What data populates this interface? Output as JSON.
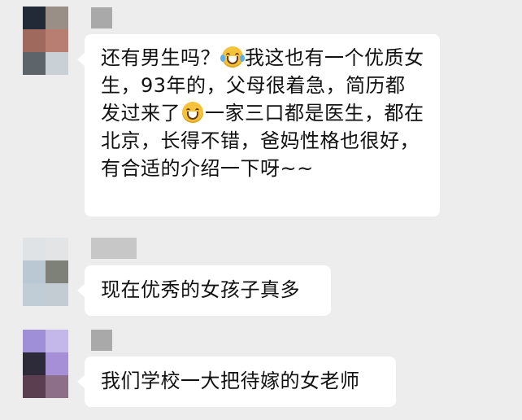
{
  "messages": [
    {
      "avatar_colors": [
        "#222a38",
        "#9a8f86",
        "#a0695e",
        "#b97e72",
        "#5d646a",
        "#c9d0d6"
      ],
      "segments": [
        {
          "type": "text",
          "value": "还有男生吗？"
        },
        {
          "type": "emoji",
          "icon": "tears-of-joy-icon"
        },
        {
          "type": "text",
          "value": "我这也有一个优质女生，93年的，父母很着急，简历都发过来了"
        },
        {
          "type": "emoji",
          "icon": "grinning-face-icon"
        },
        {
          "type": "text",
          "value": "一家三口都是医生，都在北京，长得不错，爸妈性格也很好，有合适的介绍一下呀~~"
        }
      ]
    },
    {
      "avatar_colors": [
        "#dfe3e6",
        "#e2e4e6",
        "#b9c8d2",
        "#7d8178",
        "#c1cdd6",
        "#c4ccd3"
      ],
      "text": "现在优秀的女孩子真多"
    },
    {
      "avatar_colors": [
        "#9f8fd8",
        "#c4b8ea",
        "#2d2a3a",
        "#a78fd8",
        "#5b3e4f",
        "#8e6f8a"
      ],
      "text": "我们学校一大把待嫁的女老师"
    }
  ]
}
